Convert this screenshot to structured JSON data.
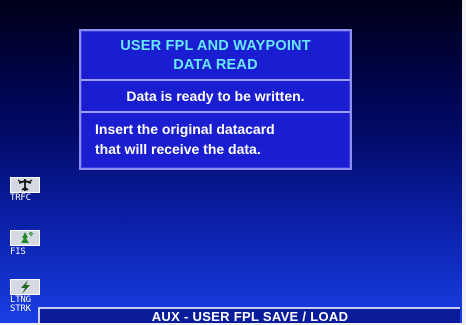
{
  "dialog": {
    "title_line1": "USER FPL AND WAYPOINT",
    "title_line2": "DATA READ",
    "message1": "Data is ready to be written.",
    "message2_line1": "Insert the original datacard",
    "message2_line2": "that will receive the data."
  },
  "side_keys": {
    "trfc": "TRFC",
    "fis": "FIS",
    "ltng_line1": "LTNG",
    "ltng_line2": "STRK"
  },
  "status_bar": {
    "label": "AUX - USER FPL SAVE / LOAD"
  },
  "colors": {
    "title": "#68e6ff",
    "dialog_bg": "#1a1ed0",
    "dialog_border": "#8a8ef0",
    "text": "#ffffff"
  },
  "icons": {
    "trfc": "traffic-aircraft-icon",
    "fis": "fis-weather-icon",
    "ltng": "lightning-strike-icon"
  }
}
